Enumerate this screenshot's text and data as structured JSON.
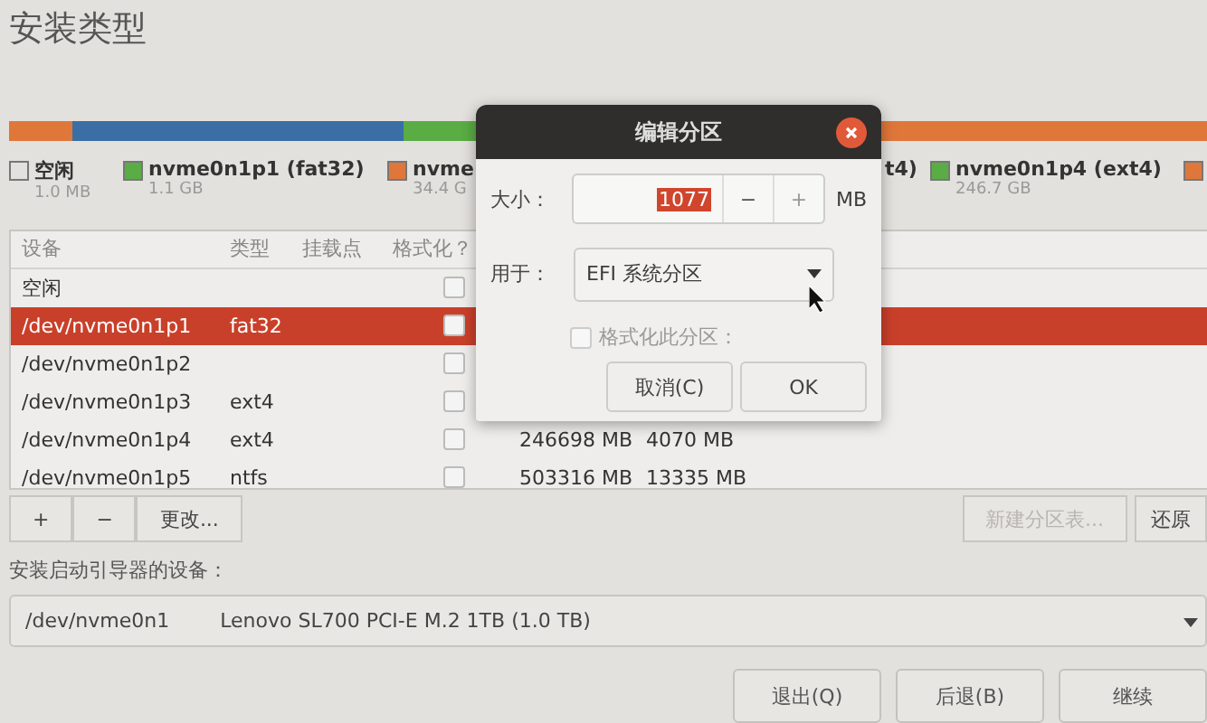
{
  "title": "安装类型",
  "legend": [
    {
      "kind": "free",
      "label": "空闲",
      "size": "1.0 MB"
    },
    {
      "kind": "swatch",
      "label": "nvme0n1p1 (fat32)",
      "size": "1.1 GB",
      "color": "#5aac44"
    },
    {
      "kind": "swatch",
      "label": "nvme",
      "size": "34.4 G",
      "color": "#e0773a"
    },
    {
      "kind": "text",
      "label": "t4)"
    },
    {
      "kind": "swatch",
      "label": "nvme0n1p4 (ext4)",
      "size": "246.7 GB",
      "color": "#5aac44"
    },
    {
      "kind": "swatch",
      "color": "#e0773a"
    }
  ],
  "table": {
    "columns": [
      "设备",
      "类型",
      "挂载点",
      "格式化？"
    ],
    "rows": [
      {
        "device": "空闲",
        "format": false,
        "selected": false
      },
      {
        "device": "/dev/nvme0n1p1",
        "type": "fat32",
        "format": false,
        "selected": true
      },
      {
        "device": "/dev/nvme0n1p2",
        "format": false,
        "selected": false
      },
      {
        "device": "/dev/nvme0n1p3",
        "type": "ext4",
        "format": false,
        "selected": false
      },
      {
        "device": "/dev/nvme0n1p4",
        "type": "ext4",
        "format": false,
        "size": "246698 MB",
        "used": "4070 MB",
        "selected": false
      },
      {
        "device": "/dev/nvme0n1p5",
        "type": "ntfs",
        "format": false,
        "size": "503316 MB",
        "used": "13335 MB",
        "selected": false
      }
    ]
  },
  "toolbar_left": [
    {
      "label": "+",
      "disabled": false
    },
    {
      "label": "−",
      "disabled": false
    },
    {
      "label": "更改...",
      "disabled": false
    }
  ],
  "toolbar_right": [
    {
      "label": "新建分区表...",
      "disabled": true
    },
    {
      "label": "还原",
      "disabled": false
    }
  ],
  "boot_label": "安装启动引导器的设备：",
  "boot_device": {
    "device": "/dev/nvme0n1",
    "description": "Lenovo SL700 PCI-E M.2 1TB (1.0 TB)"
  },
  "buttons": [
    "退出(Q)",
    "后退(B)",
    "继续"
  ],
  "dialog": {
    "title": "编辑分区",
    "size_label": "大小：",
    "size_value": "1077",
    "steppers": [
      {
        "label": "−",
        "disabled": false
      },
      {
        "label": "+",
        "disabled": true
      }
    ],
    "unit": "MB",
    "use_label": "用于：",
    "use_value": "EFI 系统分区",
    "format": {
      "label": "格式化此分区：",
      "checked": false,
      "disabled": true
    },
    "buttons": [
      "取消(C)",
      "OK"
    ]
  }
}
